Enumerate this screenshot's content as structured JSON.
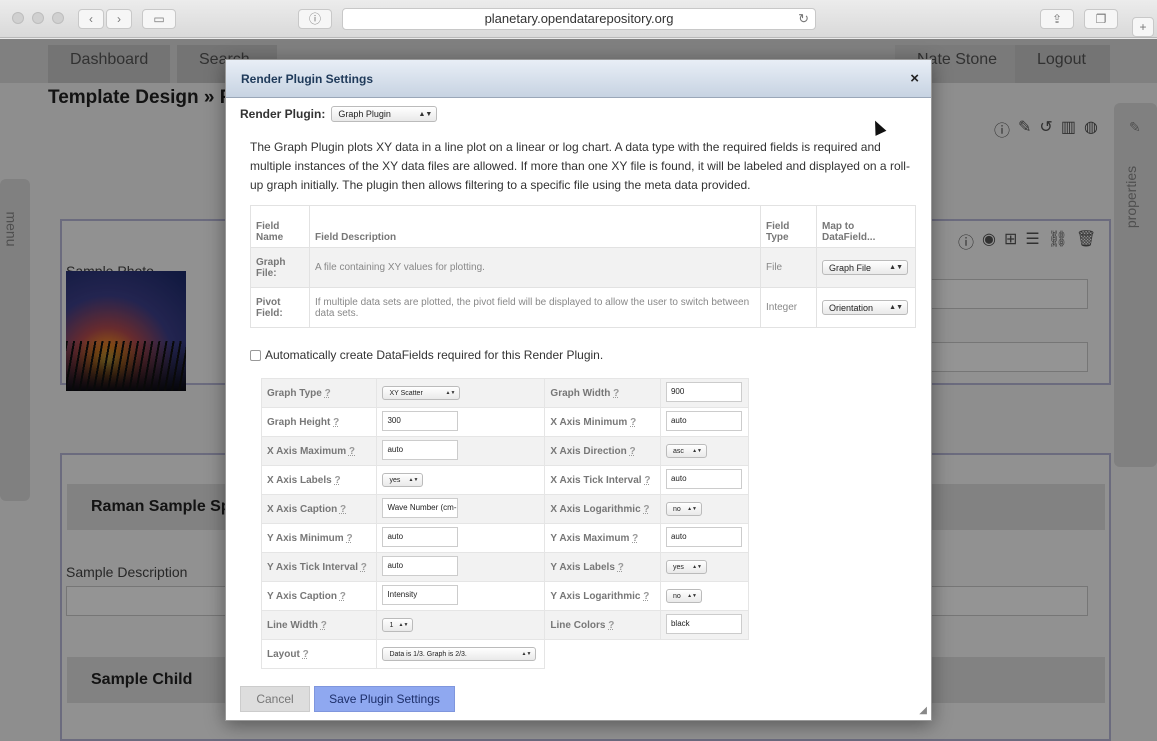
{
  "browser": {
    "url": "planetary.opendatarepository.org",
    "back_icon": "chevron-left-icon",
    "forward_icon": "chevron-right-icon"
  },
  "app": {
    "nav": {
      "dashboard": "Dashboard",
      "search": "Search",
      "user": "Nate Stone",
      "logout": "Logout"
    },
    "page_title": "Template Design »  R",
    "menu_tab": "menu",
    "properties_tab": "properties",
    "sample_photo_label": "Sample Photo",
    "raman_header": "Raman Sample Sp",
    "sample_description_label": "Sample Description",
    "sample_child_header": "Sample Child"
  },
  "modal": {
    "title": "Render Plugin Settings",
    "close_glyph": "×",
    "render_plugin_label": "Render Plugin:",
    "render_plugin_value": "Graph Plugin",
    "description": "The Graph Plugin plots XY data in a line plot on a linear or log chart. A data type with the required fields is required and multiple instances of the XY data files are allowed. If more than one XY file is found, it will be labeled and displayed on a roll-up graph initially. The plugin then allows filtering to a specific file using the meta data provided.",
    "fields_table": {
      "headers": {
        "name": "Field Name",
        "description": "Field Description",
        "type": "Field Type",
        "map": "Map to DataField..."
      },
      "rows": [
        {
          "name": "Graph File:",
          "description": "A file containing XY values for plotting.",
          "type": "File",
          "map": "Graph File"
        },
        {
          "name": "Pivot Field:",
          "description": "If multiple data sets are plotted, the pivot field will be displayed to allow the user to switch between data sets.",
          "type": "Integer",
          "map": "Orientation"
        }
      ]
    },
    "auto_create_label": "Automatically create DataFields required for this Render Plugin.",
    "help_mark": "?",
    "options": [
      {
        "l1": "Graph Type",
        "v1": "XY Scatter",
        "t1": "select",
        "l2": "Graph Width",
        "v2": "900",
        "t2": "input"
      },
      {
        "l1": "Graph Height",
        "v1": "300",
        "t1": "input",
        "l2": "X Axis Minimum",
        "v2": "auto",
        "t2": "input"
      },
      {
        "l1": "X Axis Maximum",
        "v1": "auto",
        "t1": "input",
        "l2": "X Axis Direction",
        "v2": "asc",
        "t2": "select"
      },
      {
        "l1": "X Axis Labels",
        "v1": "yes",
        "t1": "select",
        "l2": "X Axis Tick Interval",
        "v2": "auto",
        "t2": "input"
      },
      {
        "l1": "X Axis Caption",
        "v1": "Wave Number (cm-1",
        "t1": "input",
        "l2": "X Axis Logarithmic",
        "v2": "no",
        "t2": "select"
      },
      {
        "l1": "Y Axis Minimum",
        "v1": "auto",
        "t1": "input",
        "l2": "Y Axis Maximum",
        "v2": "auto",
        "t2": "input"
      },
      {
        "l1": "Y Axis Tick Interval",
        "v1": "auto",
        "t1": "input",
        "l2": "Y Axis Labels",
        "v2": "yes",
        "t2": "select"
      },
      {
        "l1": "Y Axis Caption",
        "v1": "Intensity",
        "t1": "input",
        "l2": "Y Axis Logarithmic",
        "v2": "no",
        "t2": "select"
      },
      {
        "l1": "Line Width",
        "v1": "1",
        "t1": "select",
        "l2": "Line Colors",
        "v2": "black",
        "t2": "input"
      },
      {
        "l1": "Layout",
        "v1": "Data is 1/3. Graph is 2/3.",
        "t1": "select-wide",
        "l2": "",
        "v2": "",
        "t2": "none"
      }
    ],
    "cancel_label": "Cancel",
    "save_label": "Save Plugin Settings"
  },
  "colors": {
    "primary_button": "#8fa8f0",
    "modal_header": "#c7d3e2",
    "panel_border": "#b9b9d9"
  }
}
